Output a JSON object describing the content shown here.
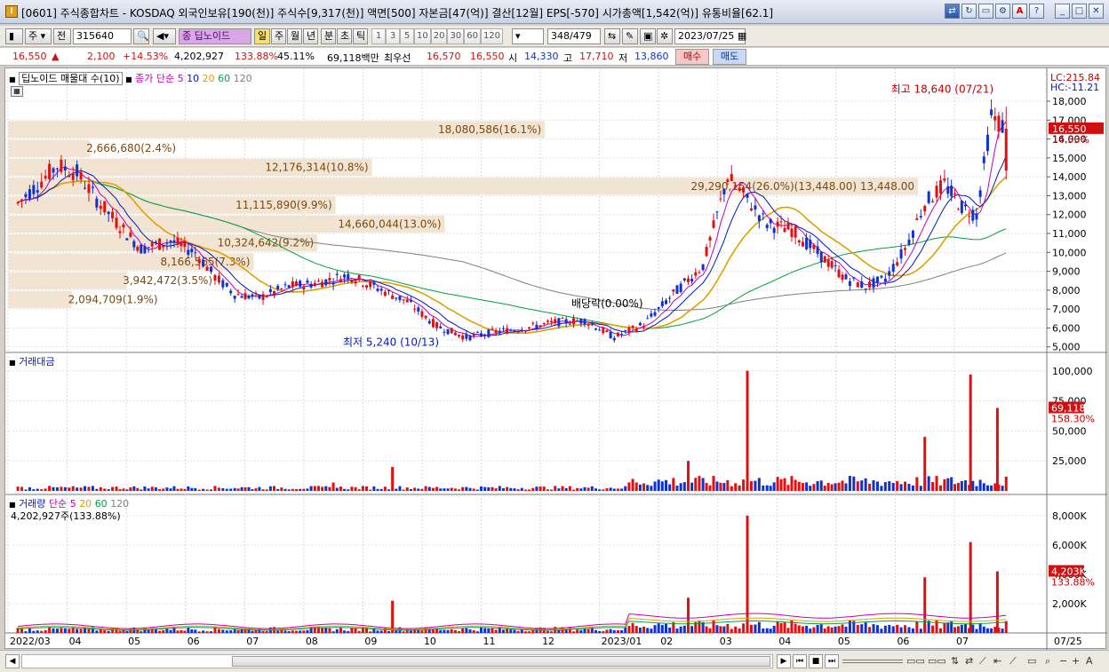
{
  "window": {
    "title": "[0601] 주식종합차트 - KOSDAQ 외국인보유[190(천)] 주식수[9,317(천)] 액면[500] 자본금[47(억)] 결산[12월] EPS[-570] 시가총액[1,542(억)] 유통비율[62.1]",
    "app_icon": "I"
  },
  "toolbar": {
    "market": "주",
    "prev_label": "전",
    "code": "315640",
    "stock_name": "딥노이드",
    "period_selected": "일",
    "periods": [
      "주",
      "월",
      "년",
      "분",
      "초",
      "틱"
    ],
    "intervals": [
      "1",
      "3",
      "5",
      "10",
      "20",
      "30",
      "60",
      "120"
    ],
    "count": "348",
    "total": "/479",
    "date": "2023/07/25",
    "stock_badge": "종"
  },
  "quote": {
    "price": "16,550",
    "arrow": "▲",
    "change": "2,100",
    "change_pct": "+14.53%",
    "volume": "4,202,927",
    "volume_ratio": "133.88%",
    "rate2": "45.11%",
    "amount": "69,118백만",
    "best_label": "최우선",
    "ask": "16,570",
    "bid": "16,550",
    "open_label": "시",
    "open": "14,330",
    "high_label": "고",
    "high": "17,710",
    "low_label": "저",
    "low": "13,860",
    "buy_label": "매수",
    "sell_label": "매도"
  },
  "price_pane": {
    "title": "딥노이드 매물대 수(10)",
    "ma_label": "종가 단순",
    "ma_periods": [
      "5",
      "10",
      "20",
      "60",
      "120"
    ],
    "lc": "LC:215.84",
    "hc": "HC:-11.21",
    "price_tag": "16,550",
    "pct_tag": "14.53%",
    "high_note": "최고 18,640 (07/21)",
    "low_note": "최저 5,240 (10/13)",
    "div_note": "배당락(0.00%)",
    "y_ticks": [
      "18,000",
      "17,000",
      "16,000",
      "15,000",
      "14,000",
      "13,000",
      "12,000",
      "11,000",
      "10,000",
      "9,000",
      "8,000",
      "7,000",
      "6,000",
      "5,000"
    ],
    "volume_profile": [
      {
        "label": "18,080,586(16.1%)",
        "price": 16500,
        "fill": 0.59
      },
      {
        "label": "2,666,680(2.4%)",
        "price": 15500,
        "fill": 0.09
      },
      {
        "label": "12,176,314(10.8%)",
        "price": 14500,
        "fill": 0.4
      },
      {
        "label": "29,290,154(26.0%)(13,448.00) 13,448.00",
        "price": 13500,
        "fill": 1.0
      },
      {
        "label": "11,115,890(9.9%)",
        "price": 12500,
        "fill": 0.36
      },
      {
        "label": "14,660,044(13.0%)",
        "price": 11500,
        "fill": 0.48
      },
      {
        "label": "10,324,642(9.2%)",
        "price": 10500,
        "fill": 0.34
      },
      {
        "label": "8,166,565(7.3%)",
        "price": 9500,
        "fill": 0.27
      },
      {
        "label": "3,942,472(3.5%)",
        "price": 8500,
        "fill": 0.13
      },
      {
        "label": "2,094,709(1.9%)",
        "price": 7500,
        "fill": 0.07
      }
    ]
  },
  "amount_pane": {
    "title": "거래대금",
    "y_ticks": [
      "100,000",
      "75,000",
      "50,000",
      "25,000"
    ],
    "value_tag": "69,118",
    "pct_tag": "158.30%"
  },
  "volume_pane": {
    "title": "거래량",
    "ma_label": "단순",
    "ma_periods": [
      "5",
      "20",
      "60",
      "120"
    ],
    "summary": "4,202,927주(133.88%)",
    "y_ticks": [
      "8,000K",
      "6,000K",
      "4,000K",
      "2,000K"
    ],
    "value_tag": "4,203K",
    "pct_tag": "133.88%"
  },
  "x_axis": {
    "labels": [
      "2022/03",
      "04",
      "05",
      "06",
      "07",
      "08",
      "09",
      "10",
      "11",
      "12",
      "2023/01",
      "02",
      "03",
      "04",
      "05",
      "06",
      "07",
      "07/25"
    ]
  },
  "colors": {
    "up": "#e01010",
    "down": "#1030d0",
    "ma5": "#c000c0",
    "ma10": "#0018c0",
    "ma20": "#e0a000",
    "ma60": "#00a040",
    "ma120": "#808080",
    "profile": "#f1e4d2"
  },
  "chart_data": [
    {
      "type": "candlestick",
      "title": "딥노이드 매물대 수(10)",
      "x_axis_months": [
        "2022/03",
        "04",
        "05",
        "06",
        "07",
        "08",
        "09",
        "10",
        "11",
        "12",
        "2023/01",
        "02",
        "03",
        "04",
        "05",
        "06",
        "07"
      ],
      "ylim": [
        4800,
        18800
      ],
      "close_path": [
        [
          "2022/03",
          12600
        ],
        [
          "2022/03",
          13600
        ],
        [
          "2022/03",
          14600
        ],
        [
          "2022/04",
          14200
        ],
        [
          "2022/04",
          12800
        ],
        [
          "2022/04",
          11600
        ],
        [
          "2022/05",
          10200
        ],
        [
          "2022/05",
          10600
        ],
        [
          "2022/06",
          10000
        ],
        [
          "2022/06",
          8700
        ],
        [
          "2022/06",
          7800
        ],
        [
          "2022/07",
          7600
        ],
        [
          "2022/07",
          8200
        ],
        [
          "2022/08",
          8400
        ],
        [
          "2022/08",
          8800
        ],
        [
          "2022/09",
          8100
        ],
        [
          "2022/09",
          7400
        ],
        [
          "2022/10",
          6100
        ],
        [
          "2022/10",
          5500
        ],
        [
          "2022/11",
          5800
        ],
        [
          "2022/11",
          6000
        ],
        [
          "2022/12",
          6300
        ],
        [
          "2022/12",
          6400
        ],
        [
          "2023/01",
          5500
        ],
        [
          "2023/01",
          6200
        ],
        [
          "2023/02",
          7800
        ],
        [
          "2023/02",
          9300
        ],
        [
          "2023/03",
          14000
        ],
        [
          "2023/03",
          12800
        ],
        [
          "2023/03",
          11500
        ],
        [
          "2023/04",
          11200
        ],
        [
          "2023/04",
          9800
        ],
        [
          "2023/05",
          8600
        ],
        [
          "2023/05",
          8200
        ],
        [
          "2023/05",
          8600
        ],
        [
          "2023/06",
          10200
        ],
        [
          "2023/06",
          12600
        ],
        [
          "2023/06",
          13600
        ],
        [
          "2023/07",
          12400
        ],
        [
          "2023/07",
          12000
        ],
        [
          "2023/07",
          17200
        ],
        [
          "2023/07",
          16550
        ]
      ],
      "ma_series": [
        "5",
        "10",
        "20",
        "60",
        "120"
      ],
      "last": 16550,
      "high": {
        "value": 18640,
        "date": "07/21"
      },
      "low": {
        "value": 5240,
        "date": "10/13"
      }
    },
    {
      "type": "bar",
      "title": "거래대금",
      "ylim": [
        0,
        105000
      ],
      "spikes": [
        {
          "month": "2022/08",
          "value": 7000
        },
        {
          "month": "2022/09",
          "value": 20000
        },
        {
          "month": "2023/02",
          "value": 25000
        },
        {
          "month": "2023/03",
          "value": 100000
        },
        {
          "month": "2023/06",
          "value": 45000
        },
        {
          "month": "2023/07",
          "value": 97000
        },
        {
          "month": "2023/07",
          "value": 69118
        }
      ]
    },
    {
      "type": "bar",
      "title": "거래량",
      "ylim": [
        0,
        8600
      ],
      "unit": "K",
      "spikes": [
        {
          "month": "2022/09",
          "value": 2200
        },
        {
          "month": "2023/02",
          "value": 2400
        },
        {
          "month": "2023/03",
          "value": 8000
        },
        {
          "month": "2023/06",
          "value": 3800
        },
        {
          "month": "2023/07",
          "value": 6200
        },
        {
          "month": "2023/07",
          "value": 4203
        }
      ],
      "summary": "4,202,927주(133.88%)"
    }
  ]
}
